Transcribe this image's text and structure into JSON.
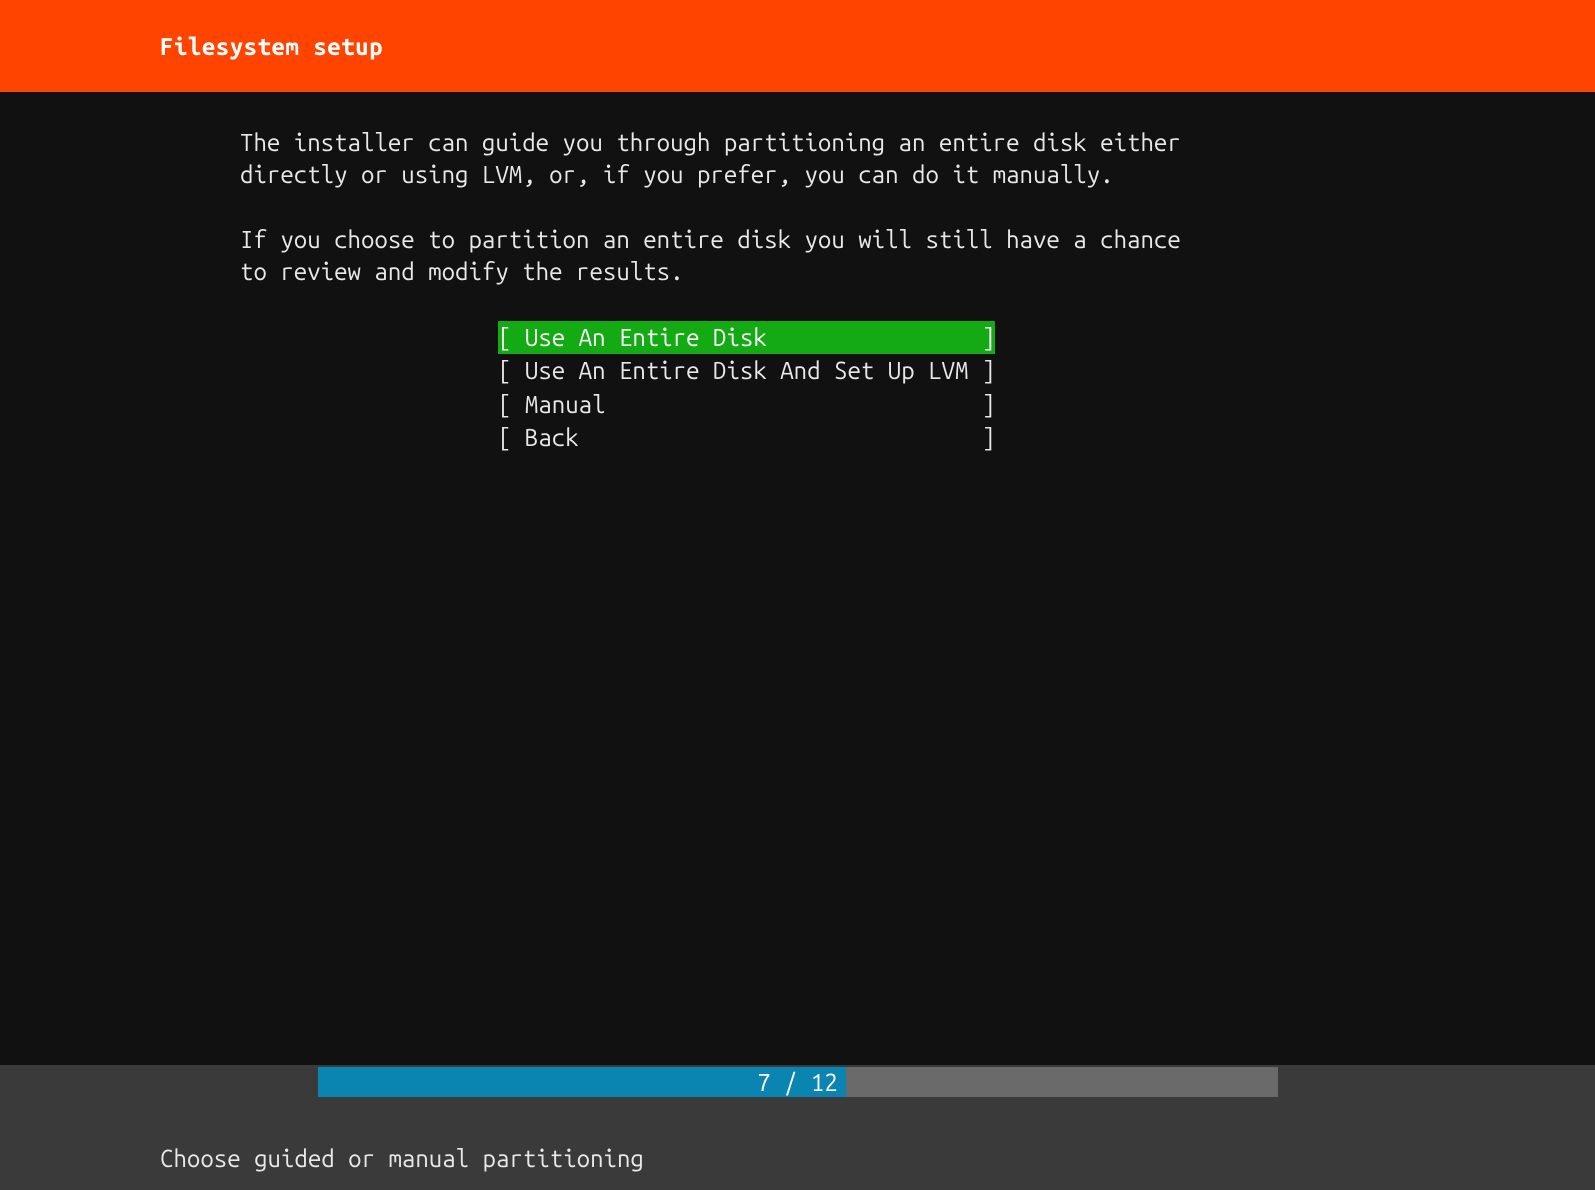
{
  "header": {
    "title": "Filesystem setup"
  },
  "content": {
    "para1": "The installer can guide you through partitioning an entire disk either\ndirectly or using LVM, or, if you prefer, you can do it manually.",
    "para2": "If you choose to partition an entire disk you will still have a chance\nto review and modify the results."
  },
  "menu": {
    "items": [
      {
        "label": "Use An Entire Disk",
        "selected": true
      },
      {
        "label": "Use An Entire Disk And Set Up LVM",
        "selected": false
      },
      {
        "label": "Manual",
        "selected": false
      },
      {
        "label": "Back",
        "selected": false
      }
    ]
  },
  "progress": {
    "current": 7,
    "total": 12,
    "label": "7 / 12"
  },
  "footer": {
    "hint": "Choose guided or manual partitioning"
  },
  "colors": {
    "header_bg": "#ff4400",
    "selected_bg": "#14aa14",
    "progress_fill": "#0a84b0"
  }
}
